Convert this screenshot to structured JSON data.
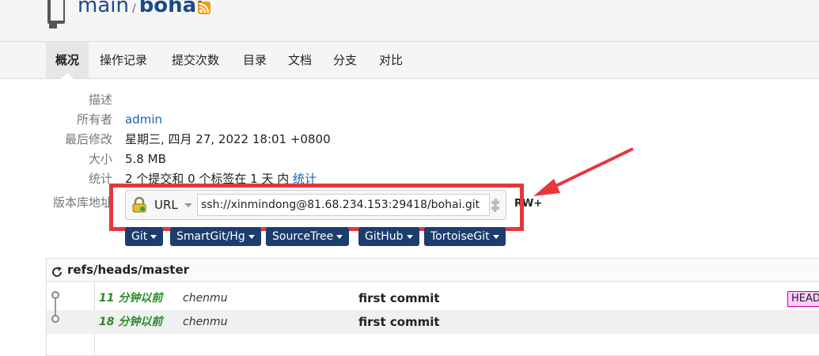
{
  "header": {
    "project": "main",
    "separator": "/",
    "repo": "bohai"
  },
  "nav": {
    "tabs": [
      {
        "label": "概况",
        "active": true
      },
      {
        "label": "操作记录"
      },
      {
        "label": "提交次数"
      },
      {
        "label": "目录"
      },
      {
        "label": "文档"
      },
      {
        "label": "分支"
      },
      {
        "label": "对比"
      }
    ]
  },
  "summary": {
    "description_label": "描述",
    "description_value": "",
    "owner_label": "所有者",
    "owner_value": "admin",
    "last_modified_label": "最后修改",
    "last_modified_value": "星期三, 四月 27, 2022 18:01 +0800",
    "size_label": "大小",
    "size_value": "5.8 MB",
    "stats_label": "统计",
    "stats_value": "2 个提交和 0 个标签在 1 天 内",
    "stats_link": "统计",
    "repo_url_label": "版本库地址"
  },
  "url_box": {
    "type": "URL",
    "value": "ssh://xinmindong@81.68.234.153:29418/bohai.git",
    "permission": "RW+"
  },
  "clients": [
    {
      "label": "Git"
    },
    {
      "label": "SmartGit/Hg"
    },
    {
      "label": "SourceTree"
    },
    {
      "label": "GitHub"
    },
    {
      "label": "TortoiseGit"
    }
  ],
  "branch": {
    "name": "refs/heads/master",
    "commits": [
      {
        "time": "11 分钟以前",
        "author": "chenmu",
        "message": "first commit",
        "ref": "HEAD"
      },
      {
        "time": "18 分钟以前",
        "author": "chenmu",
        "message": "first commit"
      }
    ]
  },
  "colors": {
    "accent": "#1a4a8a",
    "button": "#1d3d6f",
    "highlight": "#e8363d",
    "time_green": "#2a8a2a"
  }
}
